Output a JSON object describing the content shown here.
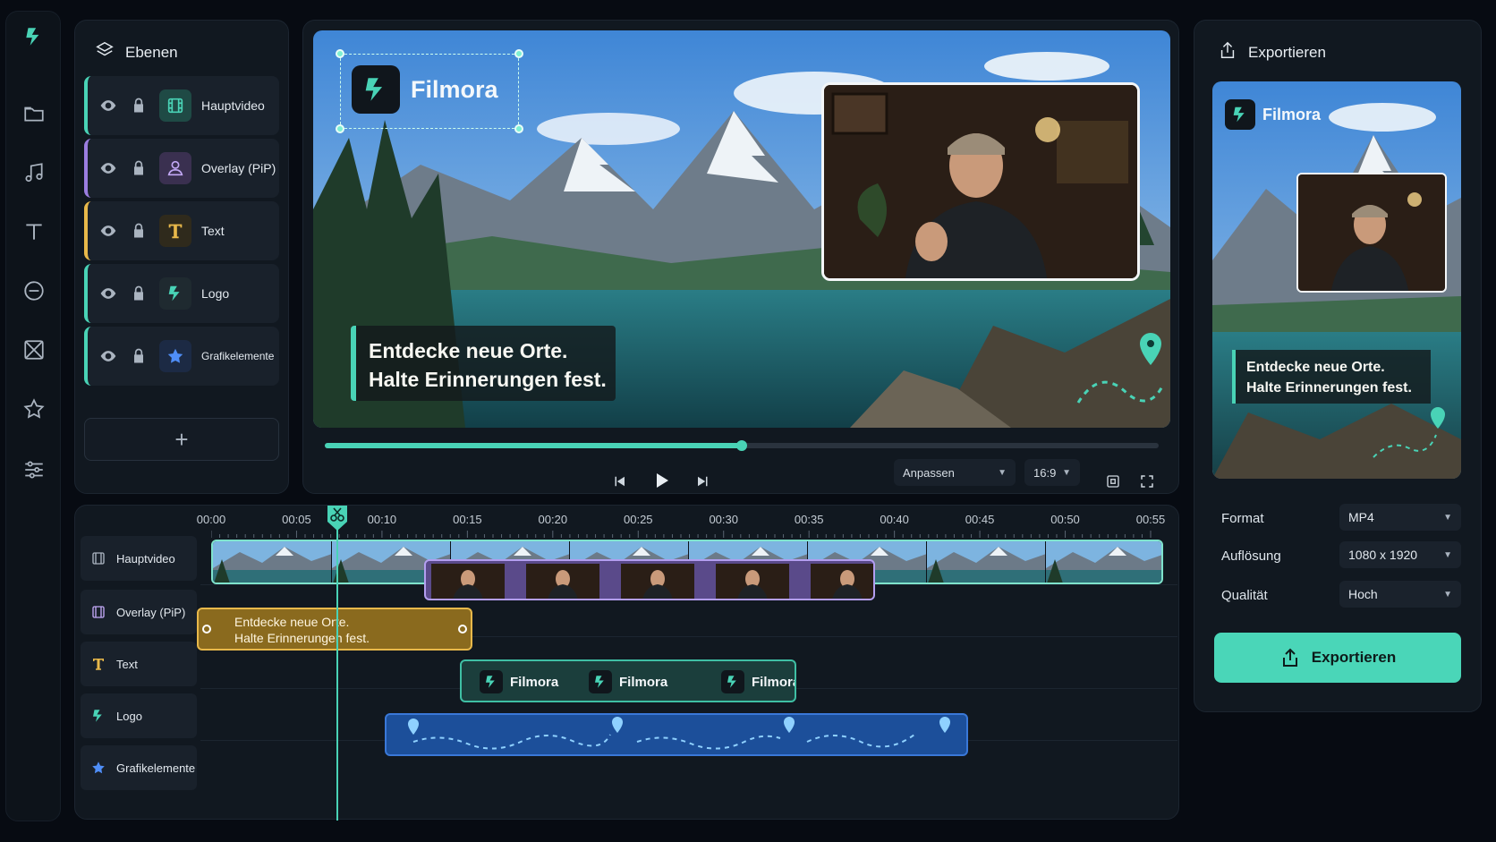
{
  "brand": {
    "name": "Filmora",
    "accent": "#49d3b6"
  },
  "rail": {
    "icons": [
      "filmora-logo-icon",
      "folder-icon",
      "music-icon",
      "text-icon",
      "effects-icon",
      "transition-icon",
      "star-icon",
      "adjust-icon"
    ]
  },
  "layers": {
    "title": "Ebenen",
    "items": [
      {
        "label": "Hauptvideo",
        "color": "#49d3b6"
      },
      {
        "label": "Overlay (PiP)",
        "color": "#9b7de0"
      },
      {
        "label": "Text",
        "color": "#e8b84a"
      },
      {
        "label": "Logo",
        "color": "#49d3b6"
      },
      {
        "label": "Grafikelemente",
        "color": "#49d3b6"
      }
    ],
    "add_label": "+"
  },
  "preview": {
    "logo_text": "Filmora",
    "caption_line1": "Entdecke neue Orte.",
    "caption_line2": "Halte Erinnerungen fest.",
    "progress": 0.5,
    "fit_label": "Anpassen",
    "ratio_label": "16:9"
  },
  "export": {
    "title": "Exportieren",
    "thumb_logo": "Filmora",
    "thumb_caption_line1": "Entdecke neue Orte.",
    "thumb_caption_line2": "Halte Erinnerungen fest.",
    "format_label": "Format",
    "format_value": "MP4",
    "resolution_label": "Auflösung",
    "resolution_value": "1080 x 1920",
    "quality_label": "Qualität",
    "quality_value": "Hoch",
    "button_label": "Exportieren"
  },
  "timeline": {
    "ticks": [
      "00:00",
      "00:05",
      "00:10",
      "00:15",
      "00:20",
      "00:25",
      "00:30",
      "00:35",
      "00:40",
      "00:45",
      "00:50",
      "00:55"
    ],
    "tracks": [
      "Hauptvideo",
      "Overlay (PiP)",
      "Text",
      "Logo",
      "Grafikelemente"
    ],
    "text_clip_line1": "Entdecke neue Orte.",
    "text_clip_line2": "Halte Erinnerungen fest.",
    "logo_clips": [
      "Filmora",
      "Filmora",
      "Filmora"
    ]
  }
}
